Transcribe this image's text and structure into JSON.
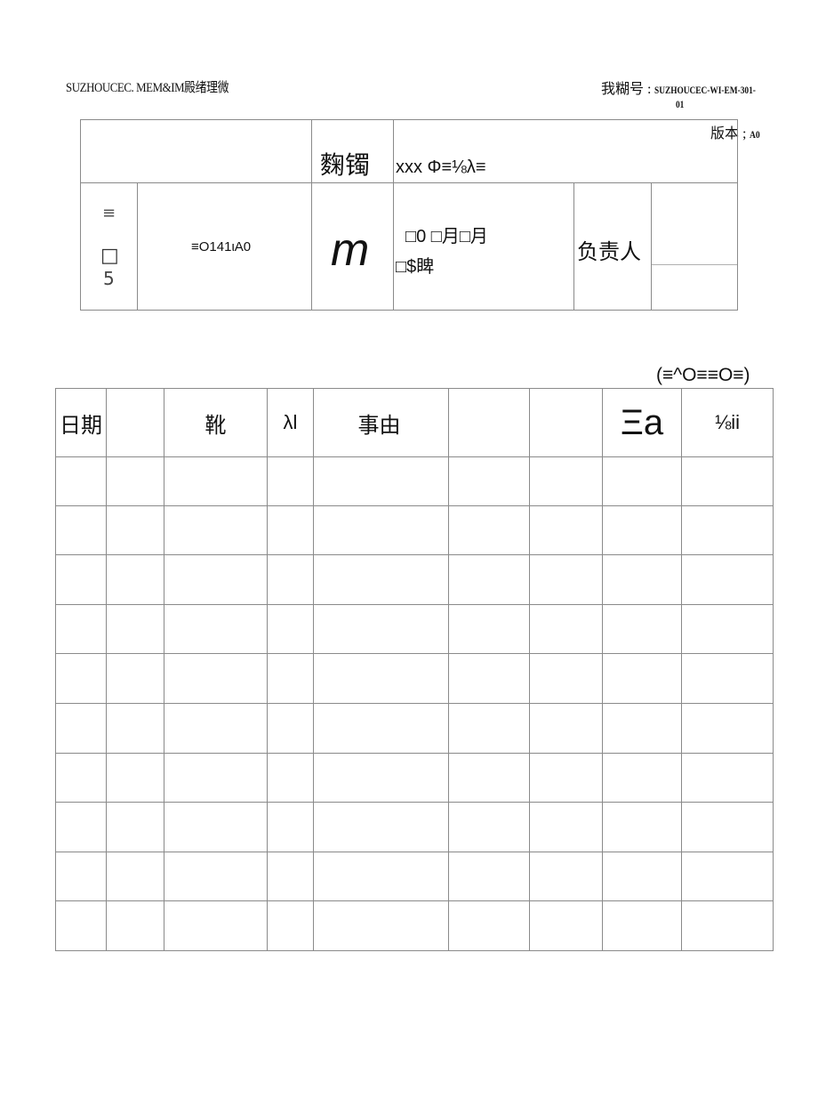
{
  "header": {
    "left_title": "SUZHOUCEC. MEM&IM殿绪理微",
    "doc_number_label": "我糊号 : ",
    "doc_number_value": "SUZHOUCEC-WI-EM-301-",
    "doc_number_suffix": "01",
    "version_label": "版本 ; ",
    "version_value": "A0"
  },
  "info_table": {
    "row1": {
      "label": "麴镯",
      "value": "xxx Φ≡⅛λ≡"
    },
    "row2": {
      "col1_top": "≡",
      "col1_mid": "□",
      "col1_bottom": "5",
      "col2": "≡O141ιA0",
      "col3": "m",
      "col4_line1": "□0 □月□月",
      "col4_line2": "□$睥",
      "col5": "负责人",
      "col6_top": "",
      "col6_bottom": ""
    }
  },
  "note": "(≡^O≡≡O≡)",
  "log_table": {
    "headers": [
      "日期",
      "",
      "靴",
      "λl",
      "事由",
      "",
      "",
      "Ξa",
      "⅛ii"
    ],
    "rows": [
      [
        "",
        "",
        "",
        "",
        "",
        "",
        "",
        "",
        ""
      ],
      [
        "",
        "",
        "",
        "",
        "",
        "",
        "",
        "",
        ""
      ],
      [
        "",
        "",
        "",
        "",
        "",
        "",
        "",
        "",
        ""
      ],
      [
        "",
        "",
        "",
        "",
        "",
        "",
        "",
        "",
        ""
      ],
      [
        "",
        "",
        "",
        "",
        "",
        "",
        "",
        "",
        ""
      ],
      [
        "",
        "",
        "",
        "",
        "",
        "",
        "",
        "",
        ""
      ],
      [
        "",
        "",
        "",
        "",
        "",
        "",
        "",
        "",
        ""
      ],
      [
        "",
        "",
        "",
        "",
        "",
        "",
        "",
        "",
        ""
      ],
      [
        "",
        "",
        "",
        "",
        "",
        "",
        "",
        "",
        ""
      ],
      [
        "",
        "",
        "",
        "",
        "",
        "",
        "",
        "",
        ""
      ]
    ]
  }
}
